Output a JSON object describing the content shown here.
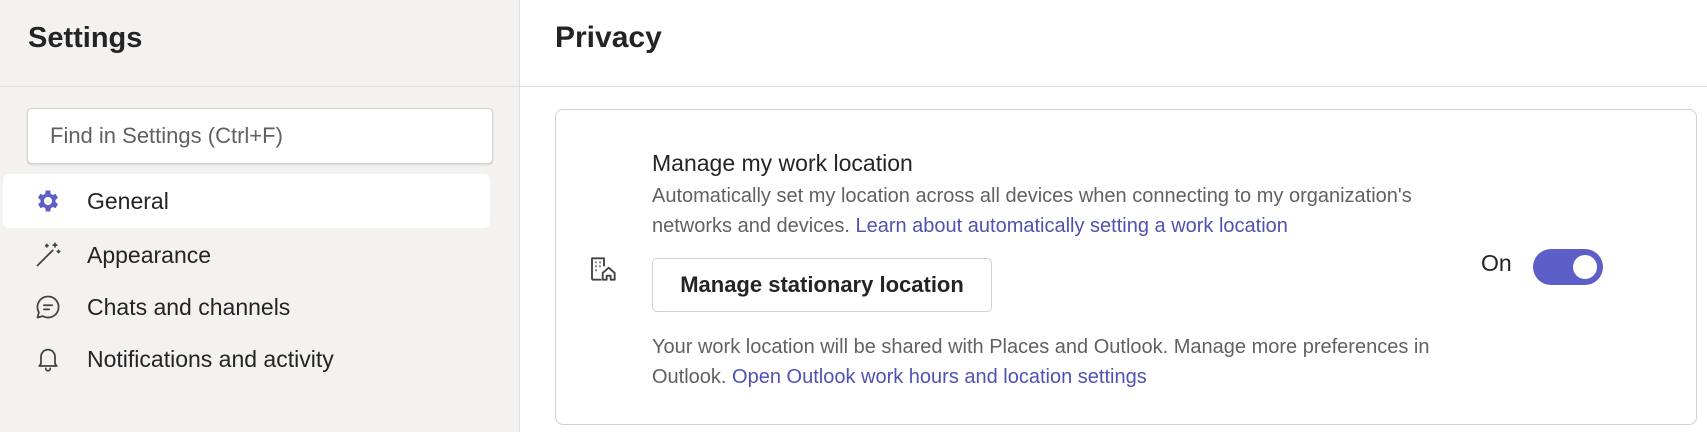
{
  "sidebar": {
    "title": "Settings",
    "search_placeholder": "Find in Settings (Ctrl+F)",
    "items": [
      {
        "label": "General",
        "icon": "gear-icon",
        "active": true
      },
      {
        "label": "Appearance",
        "icon": "magic-wand-icon",
        "active": false
      },
      {
        "label": "Chats and channels",
        "icon": "chat-bubble-icon",
        "active": false
      },
      {
        "label": "Notifications and activity",
        "icon": "bell-icon",
        "active": false
      }
    ]
  },
  "main": {
    "title": "Privacy",
    "card": {
      "icon": "building-home-icon",
      "title": "Manage my work location",
      "description": "Automatically set my location across all devices when connecting to my organization's networks and devices.",
      "description_link": "Learn about automatically setting a work location",
      "button_label": "Manage stationary location",
      "note": "Your work location will be shared with Places and Outlook. Manage more preferences in Outlook.",
      "note_link": "Open Outlook work hours and location settings",
      "toggle_label": "On",
      "toggle_on": true
    }
  },
  "colors": {
    "accent": "#5b5fc7",
    "link": "#4f52b2",
    "sidebar_bg": "#f3f2f1"
  }
}
